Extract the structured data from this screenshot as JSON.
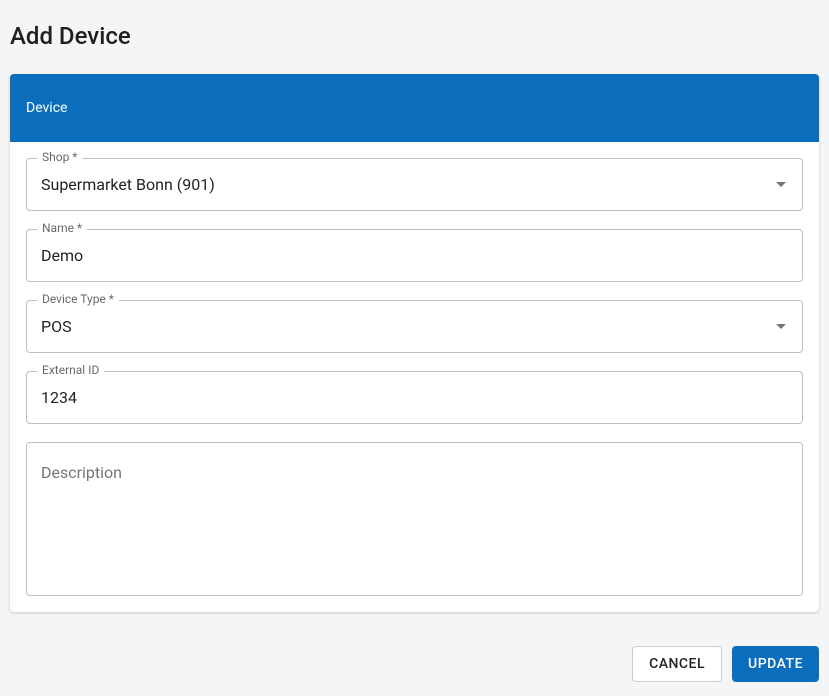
{
  "page": {
    "title": "Add Device"
  },
  "card": {
    "header": "Device"
  },
  "form": {
    "shop": {
      "label": "Shop *",
      "value": "Supermarket Bonn (901)"
    },
    "name": {
      "label": "Name *",
      "value": "Demo"
    },
    "deviceType": {
      "label": "Device Type *",
      "value": "POS"
    },
    "externalId": {
      "label": "External ID",
      "value": "1234"
    },
    "description": {
      "placeholder": "Description",
      "value": ""
    }
  },
  "actions": {
    "cancel": "Cancel",
    "update": "Update"
  }
}
